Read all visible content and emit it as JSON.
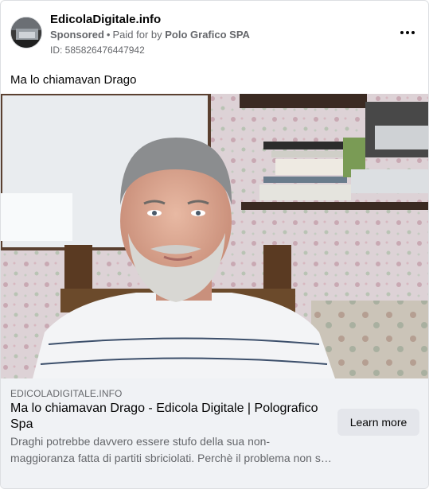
{
  "post": {
    "page_name": "EdicolaDigitale.info",
    "sponsored_label": "Sponsored",
    "separator": "•",
    "paid_for_prefix": "Paid for by",
    "paid_for_by": "Polo Grafico SPA",
    "ad_id": "ID: 585826476447942",
    "more_icon": "more-horizontal-icon",
    "caption": "Ma lo chiamavan Drago"
  },
  "link_card": {
    "domain": "EDICOLADIGITALE.INFO",
    "title": "Ma lo chiamavan Drago - Edicola Digitale | Polografico Spa",
    "description": "Draghi potrebbe davvero essere stufo della sua non-maggioranza fatta di partiti sbriciolati. Perchè il problema non sta tanto nello…",
    "cta_label": "Learn more"
  },
  "colors": {
    "card_bg": "#ffffff",
    "footer_bg": "#f0f2f5",
    "secondary_text": "#65676b",
    "cta_bg": "#e4e6eb"
  }
}
